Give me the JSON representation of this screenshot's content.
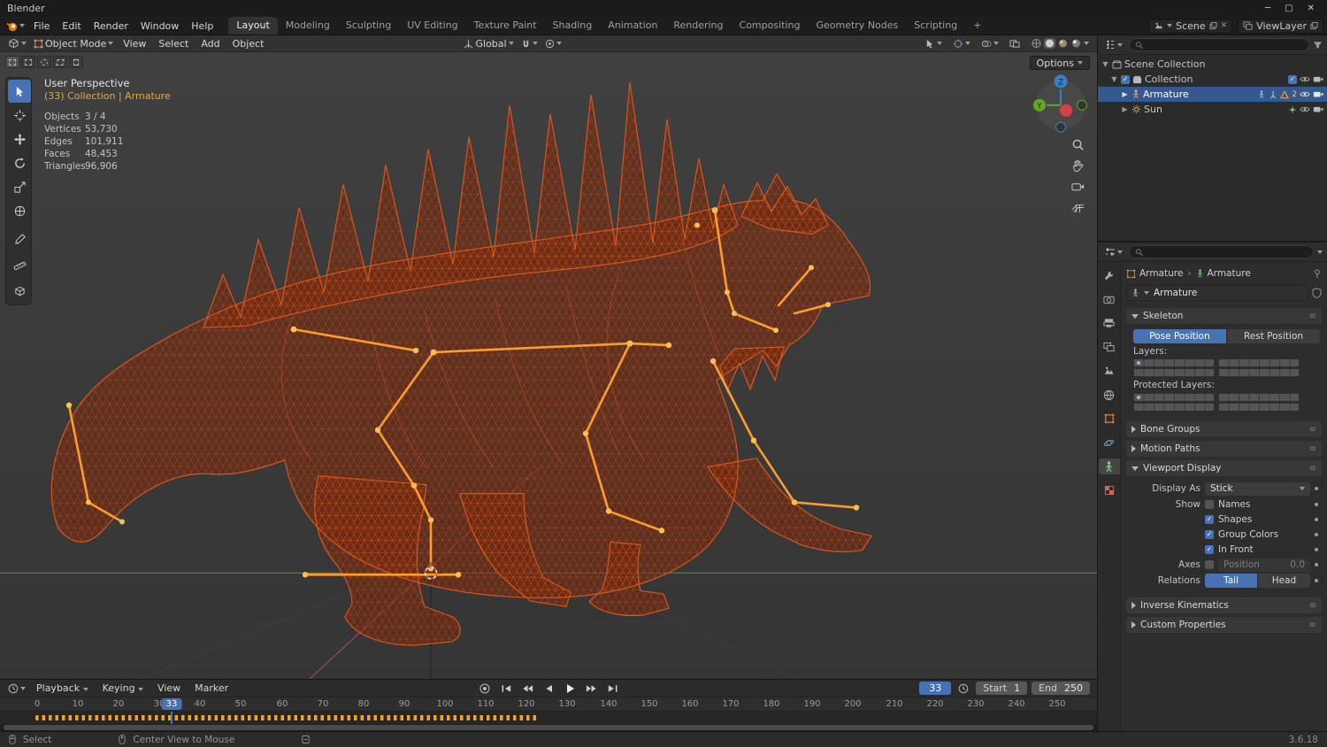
{
  "titlebar": {
    "app_title": "Blender"
  },
  "topbar": {
    "menus": [
      "File",
      "Edit",
      "Render",
      "Window",
      "Help"
    ],
    "workspaces": [
      "Layout",
      "Modeling",
      "Sculpting",
      "UV Editing",
      "Texture Paint",
      "Shading",
      "Animation",
      "Rendering",
      "Compositing",
      "Geometry Nodes",
      "Scripting"
    ],
    "add_tab": "+",
    "scene": "Scene",
    "view_layer": "ViewLayer"
  },
  "viewport_header": {
    "mode": "Object Mode",
    "menus": [
      "View",
      "Select",
      "Add",
      "Object"
    ],
    "orientation": "Global",
    "options_button": "Options"
  },
  "viewport": {
    "perspective": "User Perspective",
    "context": "(33) Collection | Armature",
    "stats": [
      {
        "label": "Objects",
        "value": "3 / 4"
      },
      {
        "label": "Vertices",
        "value": "53,730"
      },
      {
        "label": "Edges",
        "value": "101,911"
      },
      {
        "label": "Faces",
        "value": "48,453"
      },
      {
        "label": "Triangles",
        "value": "96,906"
      }
    ],
    "gizmo": {
      "y": "Y",
      "z": "Z"
    }
  },
  "outliner": {
    "items": [
      {
        "label": "Scene Collection"
      },
      {
        "label": "Collection"
      },
      {
        "label": "Armature",
        "badge": "2"
      },
      {
        "label": "Sun"
      }
    ]
  },
  "properties": {
    "breadcrumb": {
      "object": "Armature",
      "data": "Armature"
    },
    "datablock": "Armature",
    "skeleton": {
      "title": "Skeleton",
      "pose": "Pose Position",
      "rest": "Rest Position",
      "layers": "Layers:",
      "protected": "Protected Layers:"
    },
    "bone_groups": "Bone Groups",
    "motion_paths": "Motion Paths",
    "viewport_display": {
      "title": "Viewport Display",
      "display_as_label": "Display As",
      "display_as": "Stick",
      "show_label": "Show",
      "names": "Names",
      "shapes": "Shapes",
      "group_colors": "Group Colors",
      "in_front": "In Front",
      "axes": "Axes",
      "position_label": "Position",
      "position_value": "0.0",
      "relations": "Relations",
      "tail": "Tail",
      "head": "Head"
    },
    "inverse_kinematics": "Inverse Kinematics",
    "custom_properties": "Custom Properties"
  },
  "timeline": {
    "menus": [
      "Playback",
      "Keying",
      "View",
      "Marker"
    ],
    "current_frame": "33",
    "start_label": "Start",
    "start_value": "1",
    "end_label": "End",
    "end_value": "250",
    "ticks": [
      "0",
      "10",
      "20",
      "30",
      "40",
      "50",
      "60",
      "70",
      "80",
      "90",
      "100",
      "110",
      "120",
      "130",
      "140",
      "150",
      "160",
      "170",
      "180",
      "190",
      "200",
      "210",
      "220",
      "230",
      "240",
      "250"
    ]
  },
  "statusbar": {
    "select": "Select",
    "center_view": "Center View to Mouse",
    "version": "3.6.18"
  }
}
